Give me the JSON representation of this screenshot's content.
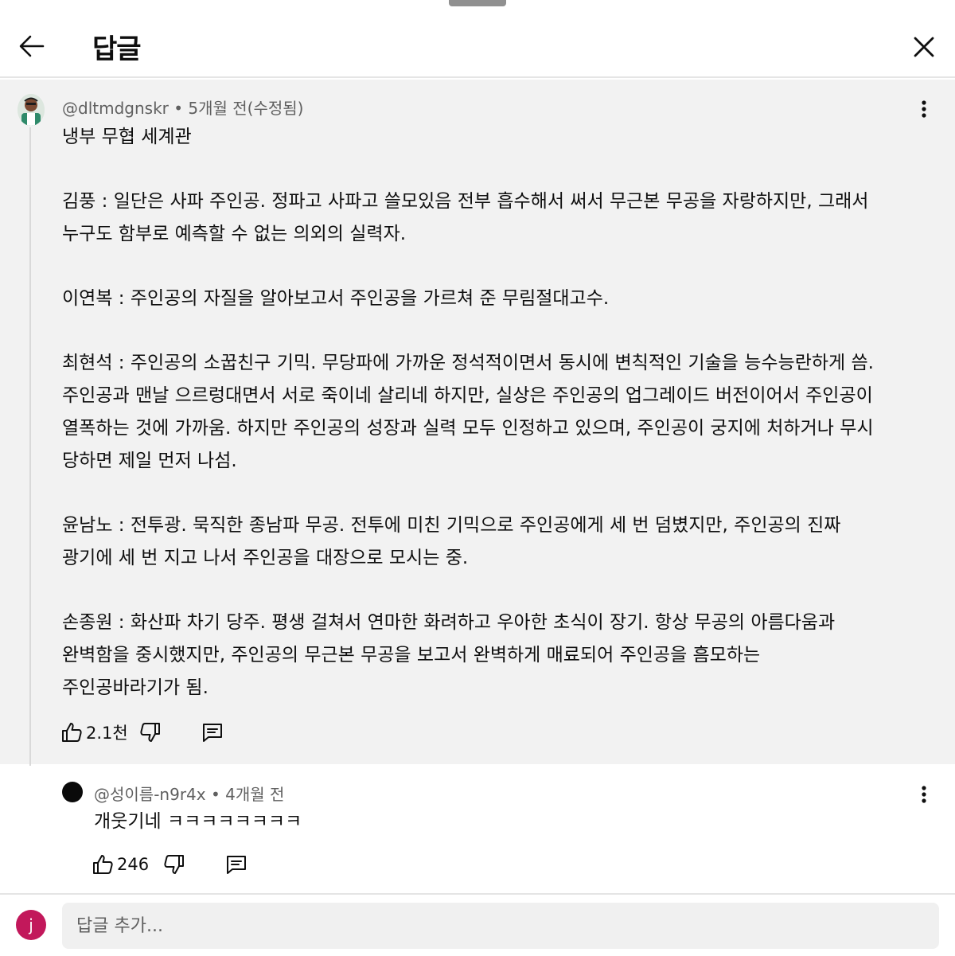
{
  "header": {
    "title": "답글"
  },
  "main_comment": {
    "handle": "@dltmdgnskr",
    "separator": " • ",
    "time": "5개월 전(수정됨)",
    "lines": [
      "냉부 무협 세계관",
      "",
      "김풍 : 일단은 사파 주인공. 정파고 사파고 쓸모있음 전부 흡수해서 써서 무근본 무공을 자랑하지만, 그래서",
      "누구도 함부로 예측할 수 없는 의외의 실력자.",
      "",
      "이연복 : 주인공의 자질을 알아보고서 주인공을 가르쳐 준 무림절대고수.",
      "",
      "최현석 : 주인공의 소꿉친구 기믹. 무당파에 가까운 정석적이면서 동시에 변칙적인 기술을 능수능란하게 씀.",
      "주인공과 맨날 으르렁대면서 서로 죽이네 살리네 하지만, 실상은 주인공의 업그레이드 버전이어서 주인공이",
      "열폭하는 것에 가까움. 하지만 주인공의 성장과 실력 모두 인정하고 있으며, 주인공이 궁지에 처하거나 무시",
      "당하면 제일 먼저 나섬.",
      "",
      "윤남노 : 전투광. 묵직한 종남파 무공. 전투에 미친 기믹으로 주인공에게 세 번 덤볐지만, 주인공의 진짜",
      "광기에 세 번 지고 나서 주인공을 대장으로 모시는 중.",
      "",
      "손종원 : 화산파 차기 당주. 평생 걸쳐서 연마한 화려하고 우아한 초식이 장기. 항상 무공의 아름다움과",
      "완벽함을 중시했지만, 주인공의 무근본 무공을 보고서 완벽하게 매료되어 주인공을 흠모하는",
      "주인공바라기가 됨."
    ],
    "like_count": "2.1천"
  },
  "reply": {
    "handle": "@성이름-n9r4x",
    "separator": " • ",
    "time": "4개월 전",
    "text": "개웃기네 ㅋㅋㅋㅋㅋㅋㅋㅋ",
    "like_count": "246"
  },
  "composer": {
    "avatar_letter": "j",
    "placeholder": "답글 추가..."
  },
  "icons": {
    "back": "arrow-left-icon",
    "close": "close-icon",
    "more": "more-vert-icon",
    "like": "thumb-up-icon",
    "dislike": "thumb-down-icon",
    "reply": "comment-icon"
  }
}
